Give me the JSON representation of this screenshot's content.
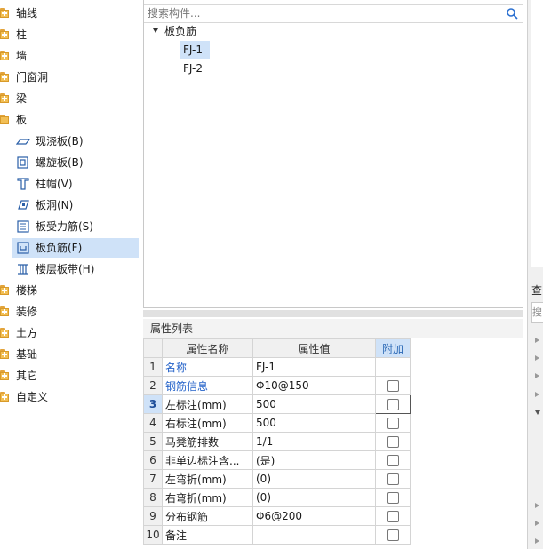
{
  "tree": {
    "items": [
      {
        "label": "轴线"
      },
      {
        "label": "柱"
      },
      {
        "label": "墙"
      },
      {
        "label": "门窗洞"
      },
      {
        "label": "梁"
      },
      {
        "label": "板"
      },
      {
        "label": "楼梯"
      },
      {
        "label": "装修"
      },
      {
        "label": "土方"
      },
      {
        "label": "基础"
      },
      {
        "label": "其它"
      },
      {
        "label": "自定义"
      }
    ],
    "board_children": [
      {
        "label": "现浇板(B)",
        "icon": "slab-icon"
      },
      {
        "label": "螺旋板(B)",
        "icon": "spiral-slab-icon"
      },
      {
        "label": "柱帽(V)",
        "icon": "column-cap-icon"
      },
      {
        "label": "板洞(N)",
        "icon": "slab-hole-icon"
      },
      {
        "label": "板受力筋(S)",
        "icon": "slab-rebar-icon"
      },
      {
        "label": "板负筋(F)",
        "icon": "negative-rebar-icon",
        "selected": true
      },
      {
        "label": "楼层板带(H)",
        "icon": "floor-strip-icon"
      }
    ]
  },
  "search": {
    "placeholder": "搜索构件..."
  },
  "component_tree": {
    "root": "板负筋",
    "children": [
      {
        "label": "FJ-1",
        "selected": true
      },
      {
        "label": "FJ-2"
      }
    ]
  },
  "properties": {
    "title": "属性列表",
    "columns": {
      "name": "属性名称",
      "value": "属性值",
      "extra": "附加"
    },
    "rows": [
      {
        "num": "1",
        "name": "名称",
        "value": "FJ-1",
        "blue": true,
        "checkbox": false
      },
      {
        "num": "2",
        "name": "钢筋信息",
        "value": "Φ10@150",
        "blue": true,
        "checkbox": true
      },
      {
        "num": "3",
        "name": "左标注(mm)",
        "value": "500",
        "checkbox": true,
        "selected": true
      },
      {
        "num": "4",
        "name": "右标注(mm)",
        "value": "500",
        "checkbox": true
      },
      {
        "num": "5",
        "name": "马凳筋排数",
        "value": "1/1",
        "checkbox": true
      },
      {
        "num": "6",
        "name": "非单边标注含...",
        "value": "(是)",
        "checkbox": true
      },
      {
        "num": "7",
        "name": "左弯折(mm)",
        "value": "(0)",
        "checkbox": true
      },
      {
        "num": "8",
        "name": "右弯折(mm)",
        "value": "(0)",
        "checkbox": true
      },
      {
        "num": "9",
        "name": "分布钢筋",
        "value": "Φ6@200",
        "checkbox": true
      },
      {
        "num": "10",
        "name": "备注",
        "value": "",
        "checkbox": true
      }
    ]
  },
  "right_panel": {
    "label": "查",
    "input_text": "搜"
  }
}
